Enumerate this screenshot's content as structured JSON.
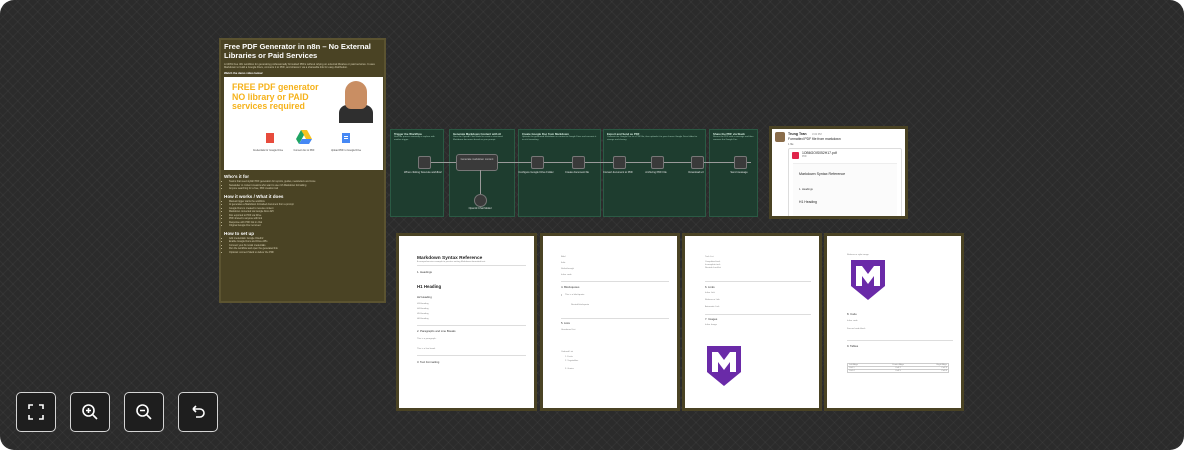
{
  "note": {
    "title": "Free PDF Generator in n8n – No External Libraries or Paid Services",
    "intro": "A 100% free n8n workflow for generating professionally formatted PDFs without relying on external libraries or paid services. It uses Markdown to build a Google Docs, converts it to PDF, and shares it via a shareable link for easy distribution.",
    "watch": "Watch the demo video below:",
    "thumbnail": {
      "headline": "FREE PDF generator NO library or PAID services required",
      "captions": [
        "Credentials for Google Drive",
        "Convert doc to PDF",
        "Upload PDF to Google Drive"
      ]
    },
    "sections": [
      {
        "heading": "Who's it for",
        "items": [
          "Teams that need stylish PDF generation for reports, guides, newsletters and more",
          "Newsletter or content creators who want to use rich Markdown formatting",
          "Anyone searching for a free, PDF creation tool"
        ]
      },
      {
        "heading": "How it works / What it does",
        "items": [
          "Manual trigger starts the workflow",
          "AI generates a Markdown formatted document from a prompt",
          "Google Docs is created to receive content",
          "Markdown converted via Google Docs API",
          "Doc exported to PDF via Drive",
          "PDF shared to anyone with link",
          "Response with PDF link in chat",
          "Original Google Doc removed"
        ]
      },
      {
        "heading": "How to set up",
        "items": [
          "Add credentials: Google OAuth2",
          "Enable Google Docs and Drive APIs",
          "Connect your AI model credentials",
          "Run the workflow and open the generated link",
          "Optional: connect Slack to deliver the PDF"
        ]
      }
    ]
  },
  "workflow": {
    "groups": [
      {
        "title": "Trigger the Workflow",
        "desc": "Start the process manually or replace with another trigger."
      },
      {
        "title": "Generate Markdown Content with AI",
        "desc": "Uses the OpenAI Chat Model to create a structured Markdown document based on your prompt."
      },
      {
        "title": "Create Google Doc from Markdown",
        "desc": "Uploads the generated Markdown as content to Google Drive and converts it to rich formatting."
      },
      {
        "title": "Export and Send as PDF",
        "desc": "Converts the Google Doc to a PDF file, then uploads it to your chosen Google Drive folder for storage and sharing."
      },
      {
        "title": "Share the PDF via Slack",
        "desc": "Shares the PDF with a message and then removes the Google Doc."
      }
    ],
    "nodes": [
      {
        "label": "When clicking 'Execute workflow'",
        "icon": "cursor-icon"
      },
      {
        "label": "Generate markdown content",
        "icon": "ai-agent-icon"
      },
      {
        "label": "OpenAI Chat Model",
        "icon": "openai-icon"
      },
      {
        "label": "Configure Google Drive Folder",
        "icon": "edit-icon"
      },
      {
        "label": "Create document file",
        "icon": "code-icon"
      },
      {
        "label": "Convert document to PDF",
        "icon": "google-drive-icon"
      },
      {
        "label": "Archiving PDF File",
        "icon": "google-drive-icon"
      },
      {
        "label": "Download url",
        "icon": "google-drive-icon"
      },
      {
        "label": "Send message",
        "icon": "slack-icon"
      }
    ]
  },
  "chat": {
    "user": "Trung Tran",
    "time": "3:32 PM",
    "message": "Formatted PDF file from markdown",
    "reply": "1 file",
    "file": "1OB6GOIS052H17.pdf",
    "file_type": "PDF",
    "preview_title": "Markdown Syntax Reference",
    "preview_h": "1. Headings",
    "preview_h1": "H1 Heading"
  },
  "pages": [
    {
      "title": "Markdown Syntax Reference",
      "subtitle": "A comprehensive example to practice writing Markdown-formatted text.",
      "sections": [
        "1. Headings",
        "H1 Heading",
        "H2 Heading",
        "H3 Heading",
        "H4 Heading",
        "H5 Heading",
        "H6 Heading",
        "2. Paragraphs and Line Breaks",
        "This is a paragraph.",
        "This is a line break",
        "3. Text Formatting"
      ]
    },
    {
      "sections": [
        "Bold",
        "Italic",
        "Strikethrough",
        "Inline code",
        "4. Blockquotes",
        "This is a blockquote",
        "Nested blockquote",
        "5. Lists",
        "Unordered List",
        "Ordered List",
        "1. Fruits",
        "2. Vegetables",
        "3. Grains"
      ]
    },
    {
      "sections": [
        "Task List",
        "Completed task",
        "Incomplete task",
        "Nested checklist",
        "6. Links",
        "Inline Link",
        "Reference Link",
        "Automatic Link",
        "7. Images",
        "Inline Image"
      ]
    },
    {
      "sections": [
        "Reference style image",
        "8. Code",
        "Inline code",
        "Fenced code block",
        "9. Tables"
      ],
      "table": {
        "headers": [
          "Left Align",
          "Center Align",
          "Right Align"
        ],
        "rows": [
          [
            "Cell 1",
            "Cell 2",
            "Cell 3"
          ],
          [
            "Cell 4",
            "Cell 5",
            "Cell 6"
          ]
        ]
      }
    }
  ],
  "controls": [
    {
      "name": "fit-view-button",
      "icon": "fullscreen-icon"
    },
    {
      "name": "zoom-in-button",
      "icon": "zoom-in-icon"
    },
    {
      "name": "zoom-out-button",
      "icon": "zoom-out-icon"
    },
    {
      "name": "reset-zoom-button",
      "icon": "undo-icon"
    }
  ],
  "colors": {
    "canvas": "#2b2b2b",
    "note": "#4a4324",
    "group": "#1e3d2f",
    "brand_purple": "#6a2aa8",
    "accent_orange": "#f6b21a"
  }
}
